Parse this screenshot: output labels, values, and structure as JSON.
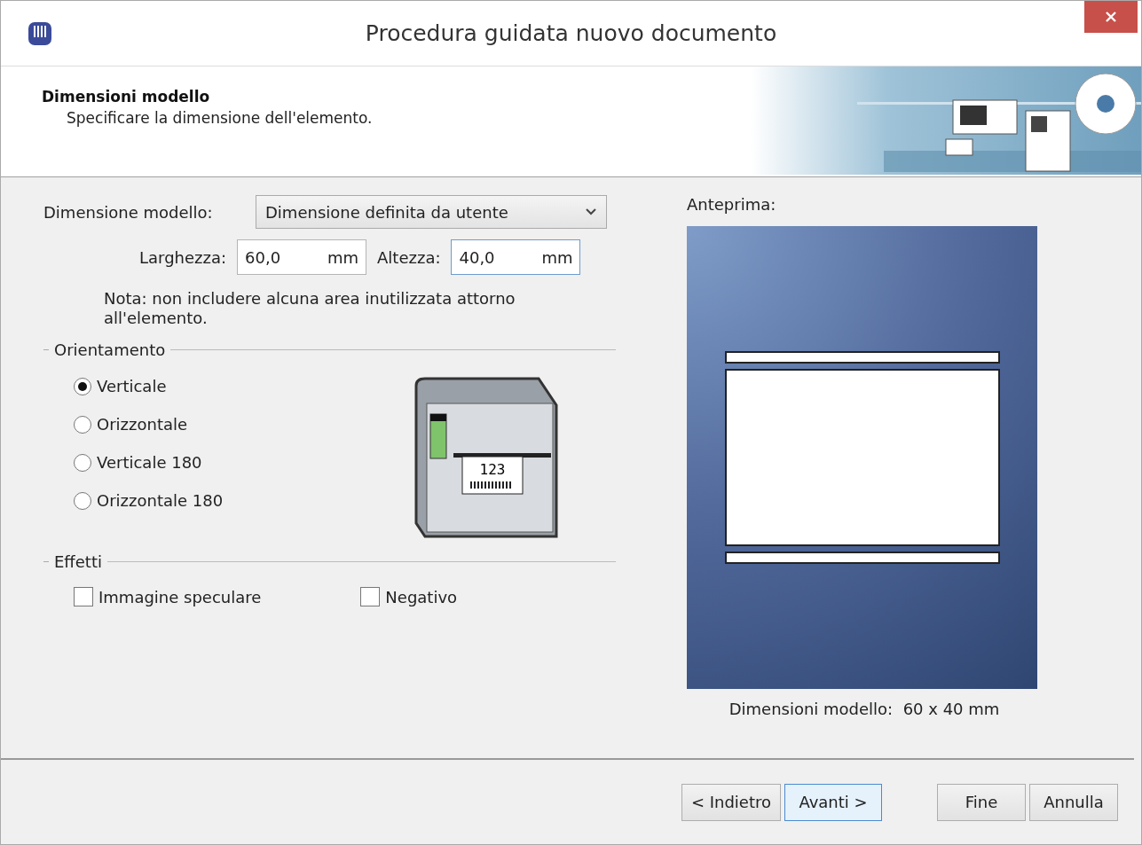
{
  "window": {
    "title": "Procedura guidata nuovo documento"
  },
  "header": {
    "title": "Dimensioni modello",
    "subtitle": "Specificare la dimensione dell'elemento."
  },
  "size": {
    "label": "Dimensione modello:",
    "value": "Dimensione definita da utente"
  },
  "width": {
    "label": "Larghezza:",
    "value": "60,0",
    "unit": "mm",
    "focused": false
  },
  "height": {
    "label": "Altezza:",
    "value": "40,0",
    "unit": "mm",
    "focused": true
  },
  "note": "Nota: non includere alcuna area inutilizzata attorno all'elemento.",
  "orientation": {
    "title": "Orientamento",
    "options": [
      {
        "label": "Verticale",
        "selected": true
      },
      {
        "label": "Orizzontale",
        "selected": false
      },
      {
        "label": "Verticale 180",
        "selected": false
      },
      {
        "label": "Orizzontale 180",
        "selected": false
      }
    ]
  },
  "printer": {
    "label_text": "123"
  },
  "effects": {
    "title": "Effetti",
    "options": [
      {
        "label": "Immagine speculare",
        "checked": false
      },
      {
        "label": "Negativo",
        "checked": false
      }
    ]
  },
  "preview": {
    "title": "Anteprima:",
    "caption": "Dimensioni modello:  60 x 40 mm"
  },
  "buttons": [
    {
      "label": "< Indietro",
      "default": false
    },
    {
      "label": "Avanti >",
      "default": true
    },
    {
      "label": "Fine",
      "default": false
    },
    {
      "label": "Annulla",
      "default": false
    }
  ]
}
